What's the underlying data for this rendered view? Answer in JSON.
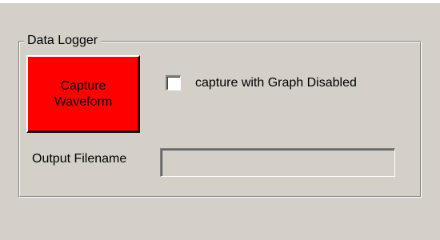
{
  "data_logger": {
    "group_title": "Data Logger",
    "capture_button": {
      "line1": "Capture",
      "line2": "Waveform",
      "color": "#ff0000"
    },
    "graph_disabled_checkbox": {
      "label": "capture with Graph Disabled",
      "checked": false
    },
    "output_filename": {
      "label": "Output Filename",
      "value": "",
      "placeholder": ""
    }
  },
  "colors": {
    "window_background": "#d4d0c8"
  }
}
